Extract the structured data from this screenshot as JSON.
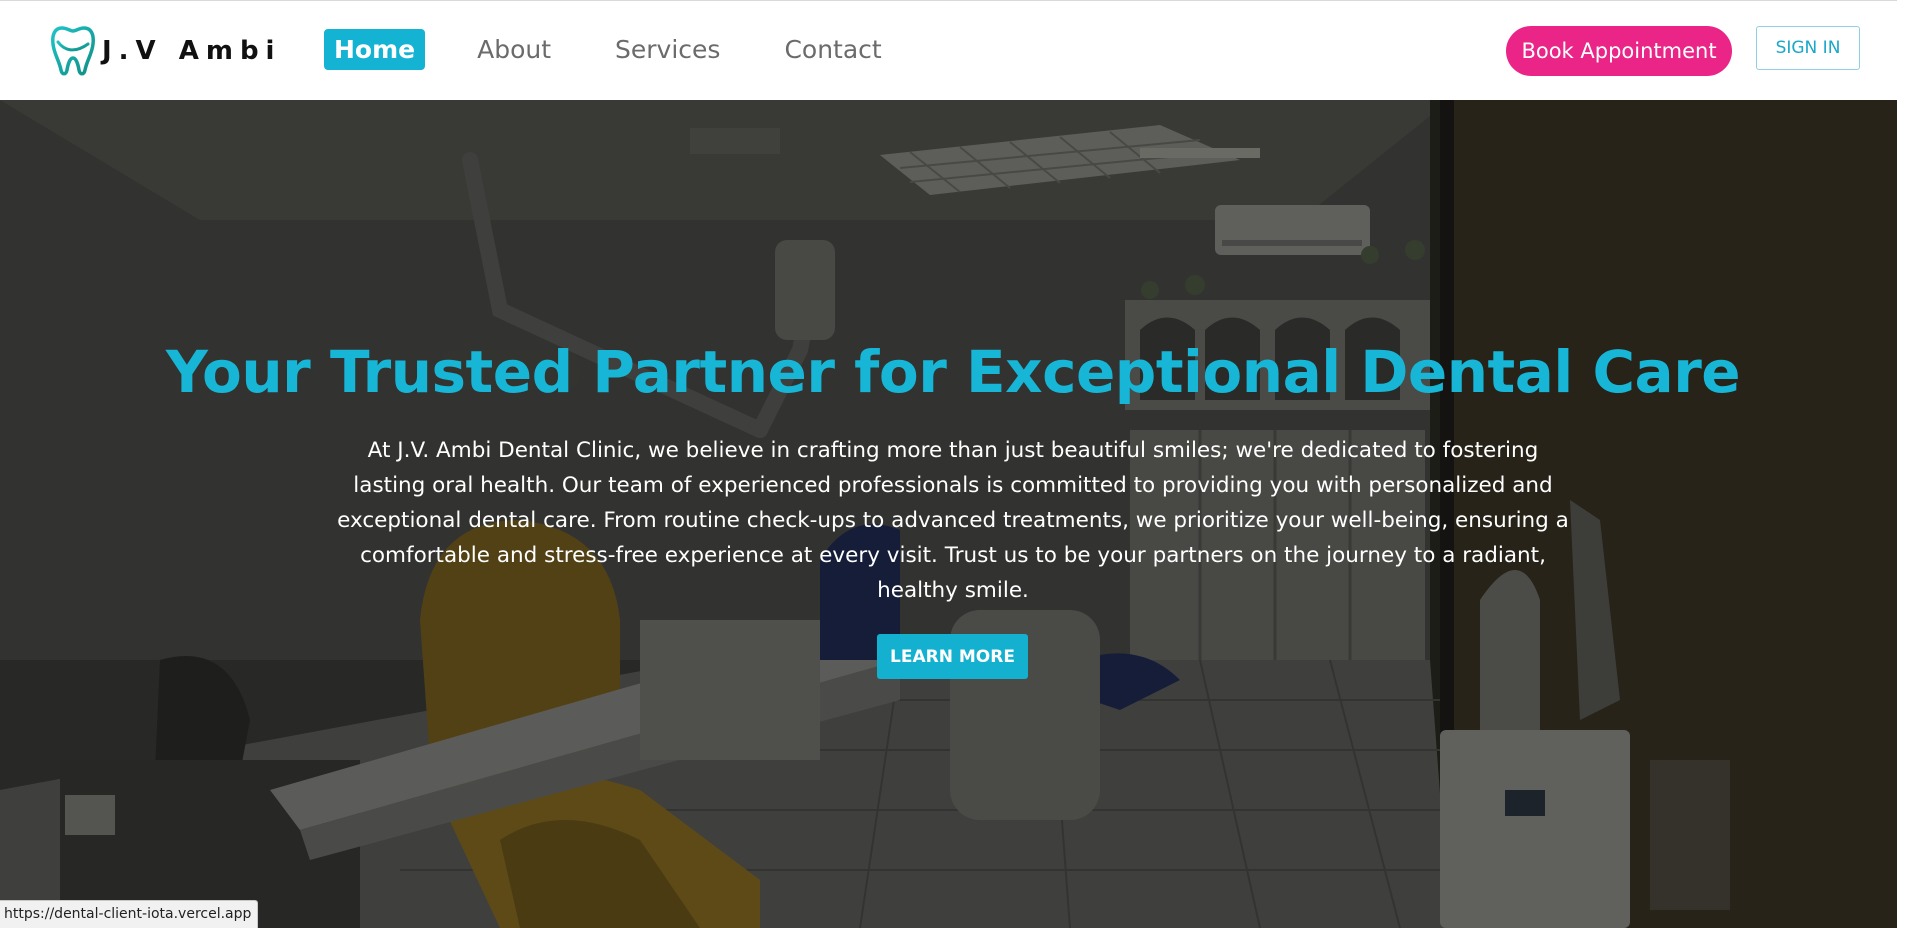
{
  "brand": {
    "name": "J.V Ambi",
    "logo_icon": "tooth-icon",
    "accent_color": "#15b3d3"
  },
  "nav": {
    "links": [
      {
        "label": "Home",
        "active": true
      },
      {
        "label": "About",
        "active": false
      },
      {
        "label": "Services",
        "active": false
      },
      {
        "label": "Contact",
        "active": false
      }
    ],
    "book_label": "Book Appointment",
    "book_color": "#ea2587",
    "signin_label": "SIGN IN"
  },
  "hero": {
    "title": "Your Trusted Partner for Exceptional Dental Care",
    "text": "At J.V. Ambi Dental Clinic, we believe in crafting more than just beautiful smiles; we're dedicated to fostering lasting oral health. Our team of experienced professionals is committed to providing you with personalized and exceptional dental care. From routine check-ups to advanced treatments, we prioritize your well-being, ensuring a comfortable and stress-free experience at every visit. Trust us to be your partners on the journey to a radiant, healthy smile.",
    "cta_label": "LEARN MORE",
    "background": "dental-clinic-photo"
  },
  "status_bar": {
    "url": "https://dental-client-iota.vercel.app"
  }
}
